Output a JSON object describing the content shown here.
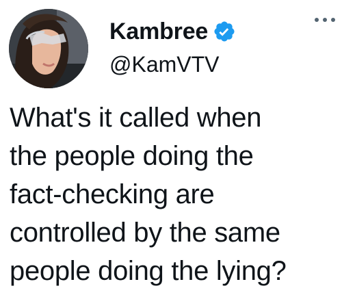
{
  "author": {
    "display_name": "Kambree",
    "handle": "@KamVTV",
    "verified": true,
    "avatar_icon": "profile-photo"
  },
  "menu": {
    "icon": "more-horizontal-icon"
  },
  "tweet": {
    "lines": [
      "What's it called when",
      "the people doing the",
      "fact-checking are",
      "controlled by the same",
      "people doing the lying?"
    ]
  },
  "colors": {
    "verified_badge": "#1d9bf0",
    "text": "#0f1419",
    "more_dots": "#536471"
  }
}
